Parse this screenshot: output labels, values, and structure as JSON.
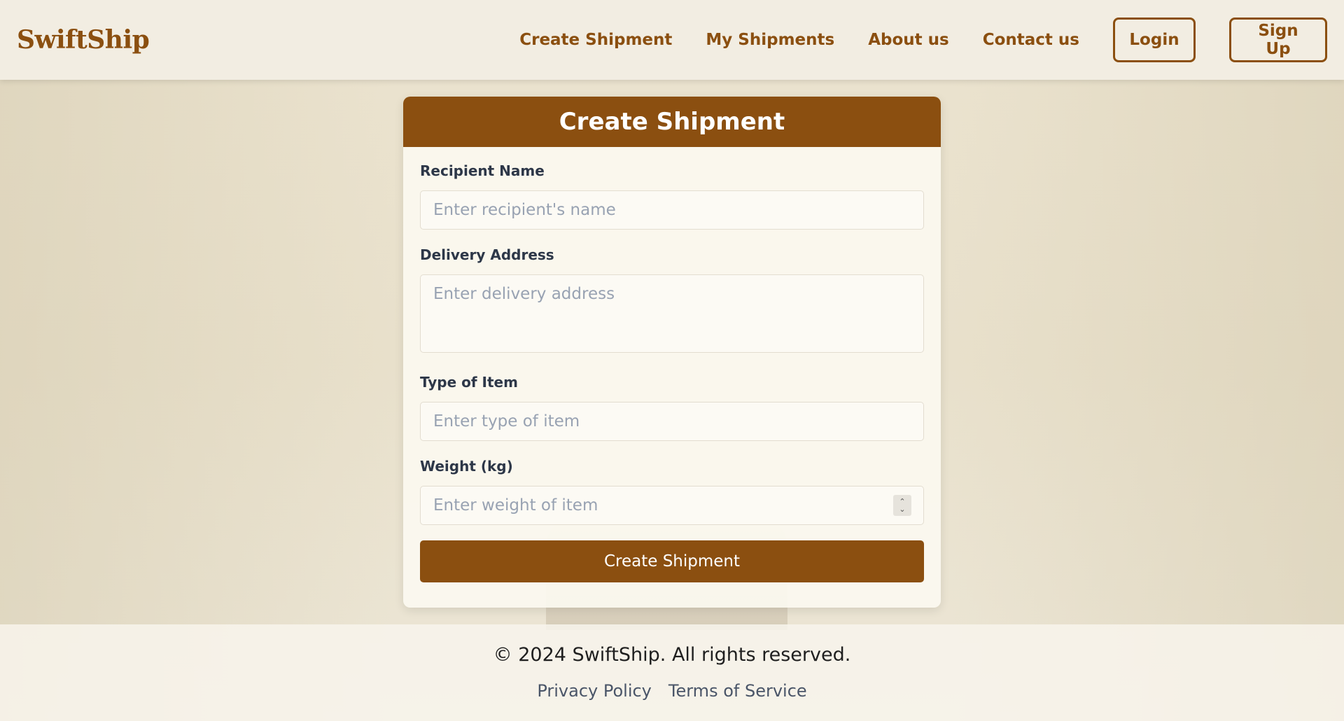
{
  "brand": {
    "name": "SwiftShip"
  },
  "nav": {
    "items": [
      "Create Shipment",
      "My Shipments",
      "About us",
      "Contact us"
    ],
    "login_label": "Login",
    "signup_label": "Sign Up"
  },
  "form": {
    "title": "Create Shipment",
    "recipient": {
      "label": "Recipient Name",
      "placeholder": "Enter recipient's name"
    },
    "address": {
      "label": "Delivery Address",
      "placeholder": "Enter delivery address"
    },
    "item_type": {
      "label": "Type of Item",
      "placeholder": "Enter type of item"
    },
    "weight": {
      "label": "Weight (kg)",
      "placeholder": "Enter weight of item"
    },
    "submit_label": "Create Shipment"
  },
  "footer": {
    "copyright": "© 2024 SwiftShip. All rights reserved.",
    "links": [
      "Privacy Policy",
      "Terms of Service"
    ]
  },
  "colors": {
    "brand": "#8b4f10",
    "background": "#ebe3cf"
  }
}
